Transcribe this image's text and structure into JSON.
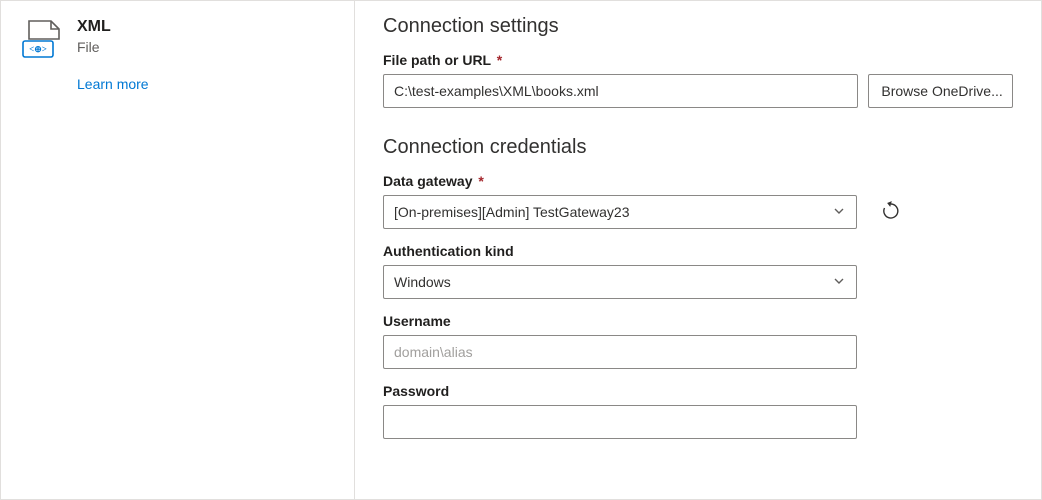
{
  "sidebar": {
    "title": "XML",
    "subtitle": "File",
    "learn_more": "Learn more"
  },
  "settings": {
    "heading": "Connection settings",
    "filepath_label": "File path or URL",
    "filepath_required": "*",
    "filepath_value": "C:\\test-examples\\XML\\books.xml",
    "browse_label": "Browse OneDrive..."
  },
  "credentials": {
    "heading": "Connection credentials",
    "gateway_label": "Data gateway",
    "gateway_required": "*",
    "gateway_value": "[On-premises][Admin] TestGateway23",
    "auth_label": "Authentication kind",
    "auth_value": "Windows",
    "username_label": "Username",
    "username_placeholder": "domain\\alias",
    "username_value": "",
    "password_label": "Password",
    "password_value": ""
  }
}
